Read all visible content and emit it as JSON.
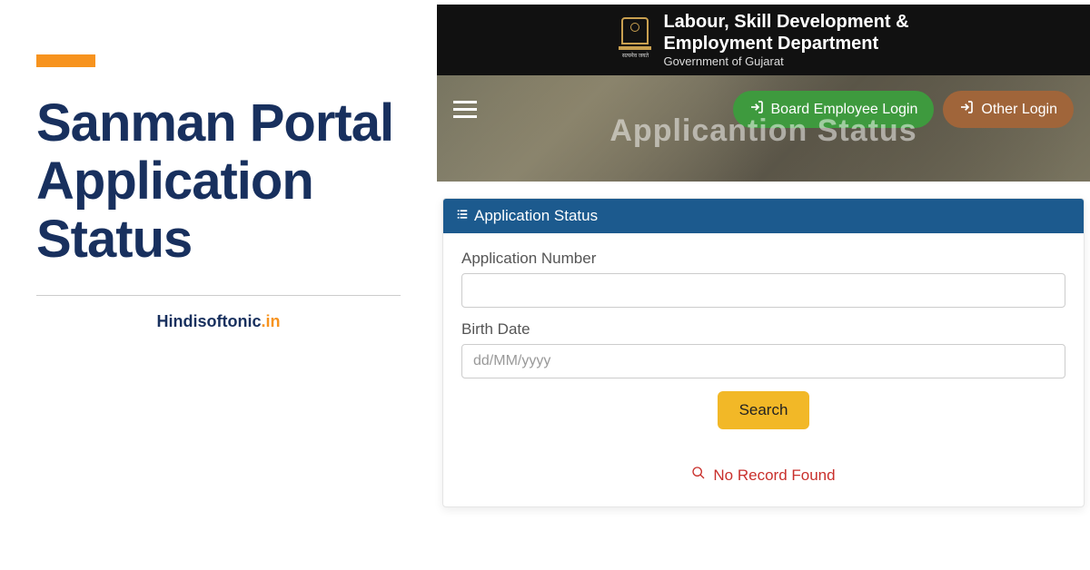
{
  "left": {
    "title": "Sanman Portal Application Status",
    "source_prefix": "Hindisoftonic",
    "source_suffix": ".in"
  },
  "banner": {
    "dept_line1": "Labour, Skill Development &",
    "dept_line2": "Employment Department",
    "dept_sub": "Government of Gujarat",
    "page_title": "Applicantion Status",
    "board_login": "Board Employee Login",
    "other_login": "Other Login"
  },
  "panel": {
    "header": "Application Status",
    "app_num_label": "Application Number",
    "birth_label": "Birth Date",
    "birth_placeholder": "dd/MM/yyyy",
    "search_label": "Search",
    "no_record": "No Record Found"
  }
}
